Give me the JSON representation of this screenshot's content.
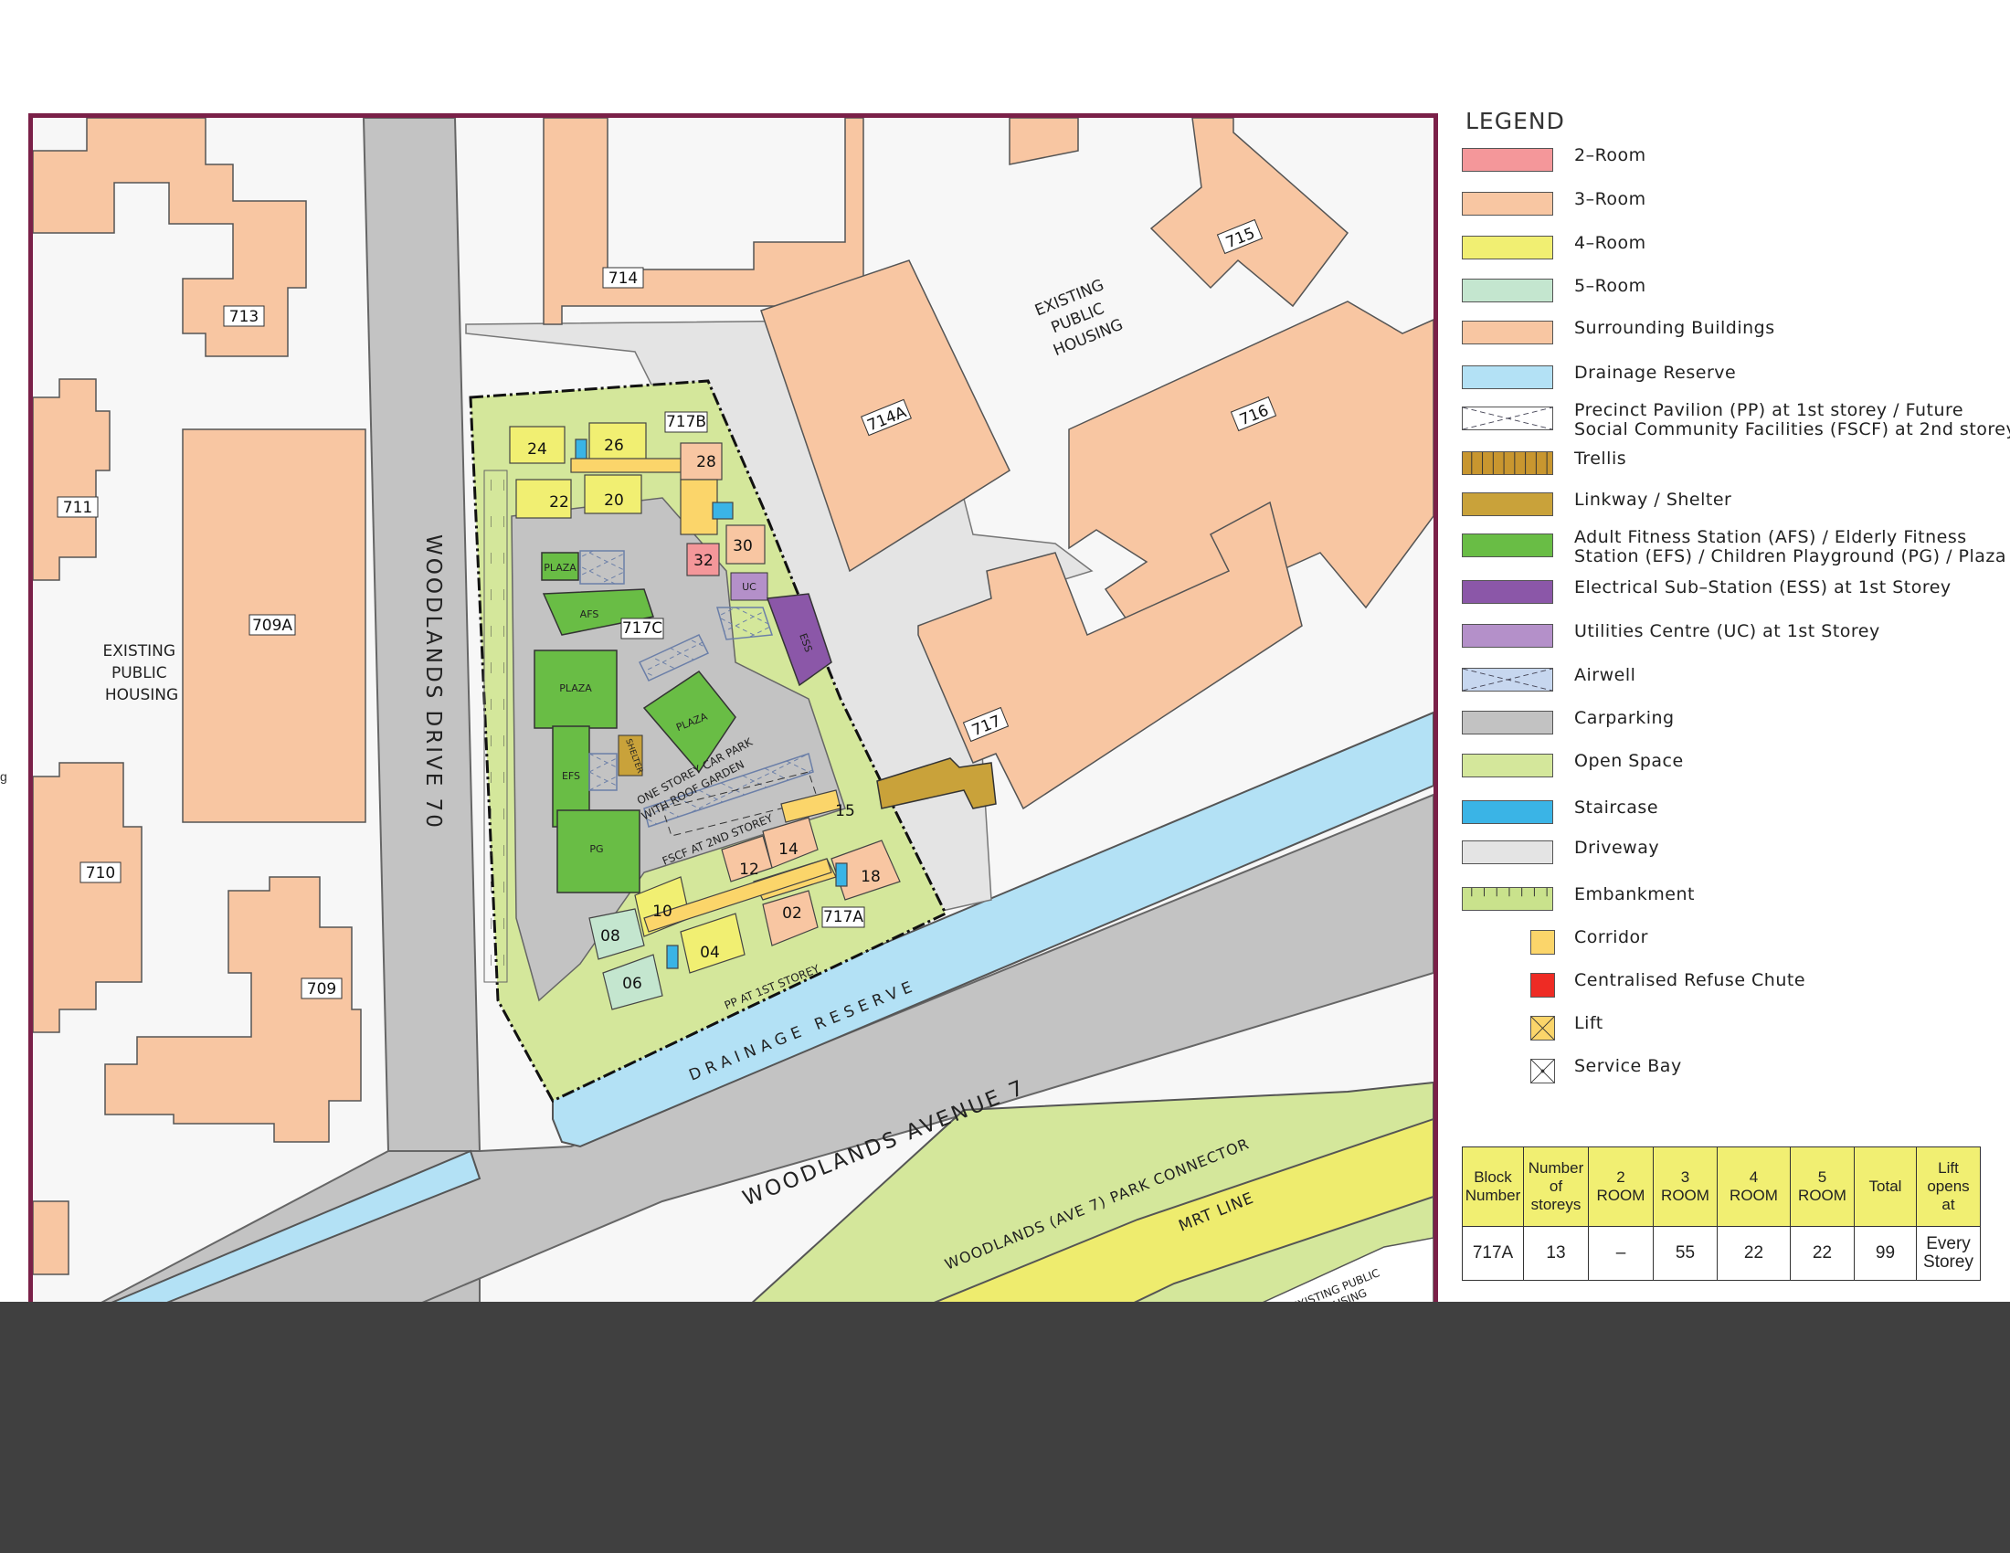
{
  "map": {
    "street_names": {
      "woodlands_drive_70": "WOODLANDS DRIVE 70",
      "woodlands_avenue_7": "WOODLANDS AVENUE 7",
      "park_connector": "WOODLANDS (AVE 7) PARK CONNECTOR",
      "mrt_line": "MRT LINE",
      "drainage_reserve": "DRAINAGE RESERVE"
    },
    "area_labels": {
      "existing_public_housing_west": [
        "EXISTING",
        "PUBLIC",
        "HOUSING"
      ],
      "existing_public_housing_north": [
        "EXISTING",
        "PUBLIC",
        "HOUSING"
      ],
      "existing_public_housing_south": [
        "EXISTING PUBLIC",
        "HOUSING"
      ]
    },
    "surrounding_block_numbers": {
      "b713": "713",
      "b714": "714",
      "b715": "715",
      "b714a": "714A",
      "b716": "716",
      "b717": "717",
      "b711": "711",
      "b709a": "709A",
      "b710": "710",
      "b709": "709"
    },
    "site": {
      "block_numbers": {
        "b717a": "717A",
        "b717b": "717B",
        "b717c": "717C"
      },
      "unit_stack_numbers": {
        "s24": "24",
        "s26": "26",
        "s22": "22",
        "s20": "20",
        "s28": "28",
        "s32": "32",
        "s30": "30",
        "s15": "15",
        "s14": "14",
        "s12": "12",
        "s10": "10",
        "s18": "18",
        "s02": "02",
        "s08": "08",
        "s04": "04",
        "s06": "06"
      },
      "facility_labels": {
        "plaza_1": "PLAZA",
        "plaza_2": "PLAZA",
        "plaza_3": "PLAZA",
        "afs": "AFS",
        "efs": "EFS",
        "pg": "PG",
        "uc": "UC",
        "ess": "ESS",
        "shelter": "SHELTER"
      },
      "annotations": {
        "carpark_line1": "ONE STOREY CAR PARK",
        "carpark_line2": "WITH ROOF GARDEN",
        "fscf": "FSCF AT 2ND STOREY",
        "pp": "PP AT 1ST STOREY"
      }
    }
  },
  "legend": {
    "title": "LEGEND",
    "items": [
      {
        "label": "2–Room",
        "color": "#f4979a",
        "pattern": "solid"
      },
      {
        "label": "3–Room",
        "color": "#f8c6a2",
        "pattern": "solid"
      },
      {
        "label": "4–Room",
        "color": "#f1ef72",
        "pattern": "solid"
      },
      {
        "label": "5–Room",
        "color": "#c4e6cf",
        "pattern": "solid"
      },
      {
        "label": "Surrounding Buildings",
        "color": "#f8c6a2",
        "pattern": "solid"
      },
      {
        "label": "Drainage Reserve",
        "color": "#b3e1f5",
        "pattern": "solid"
      },
      {
        "label": "Precinct Pavilion (PP) at 1st storey / Future",
        "label2": "Social Community Facilities (FSCF) at 2nd storey",
        "color": "#ffffff",
        "pattern": "cross-dashed"
      },
      {
        "label": "Trellis",
        "color": "#c8962f",
        "pattern": "trellis"
      },
      {
        "label": "Linkway / Shelter",
        "color": "#c9a23a",
        "pattern": "solid"
      },
      {
        "label": "Adult Fitness Station (AFS) / Elderly Fitness",
        "label2": "Station (EFS) / Children Playground (PG) / Plaza",
        "color": "#69bd45",
        "pattern": "solid"
      },
      {
        "label": "Electrical Sub–Station (ESS) at 1st Storey",
        "color": "#8b57a8",
        "pattern": "solid"
      },
      {
        "label": "Utilities Centre (UC) at 1st Storey",
        "color": "#b490c9",
        "pattern": "solid"
      },
      {
        "label": "Airwell",
        "color": "#c7d7ef",
        "pattern": "cross-dashed"
      },
      {
        "label": "Carparking",
        "color": "#c2c2c2",
        "pattern": "solid"
      },
      {
        "label": "Open Space",
        "color": "#d4e79b",
        "pattern": "solid"
      },
      {
        "label": "Staircase",
        "color": "#3ab4e6",
        "pattern": "solid"
      },
      {
        "label": "Driveway",
        "color": "#e4e4e4",
        "pattern": "solid"
      },
      {
        "label": "Embankment",
        "color": "#c9e28c",
        "pattern": "embankment"
      },
      {
        "label": "Corridor",
        "color": "#fbd56a",
        "pattern": "small-solid"
      },
      {
        "label": "Centralised Refuse Chute",
        "color": "#ee2b24",
        "pattern": "small-solid"
      },
      {
        "label": "Lift",
        "color": "#fbd56a",
        "pattern": "small-cross"
      },
      {
        "label": "Service Bay",
        "color": "#ffffff",
        "pattern": "small-cross-dot"
      }
    ]
  },
  "unit_table": {
    "headers": [
      "Block\nNumber",
      "Number\nof\nstoreys",
      "2\nROOM",
      "3\nROOM",
      "4\nROOM",
      "5\nROOM",
      "Total",
      "Lift\nopens\nat"
    ],
    "rows": [
      [
        "717A",
        "13",
        "–",
        "55",
        "22",
        "22",
        "99",
        "Every\nStorey"
      ]
    ]
  },
  "edge_mark": "g"
}
